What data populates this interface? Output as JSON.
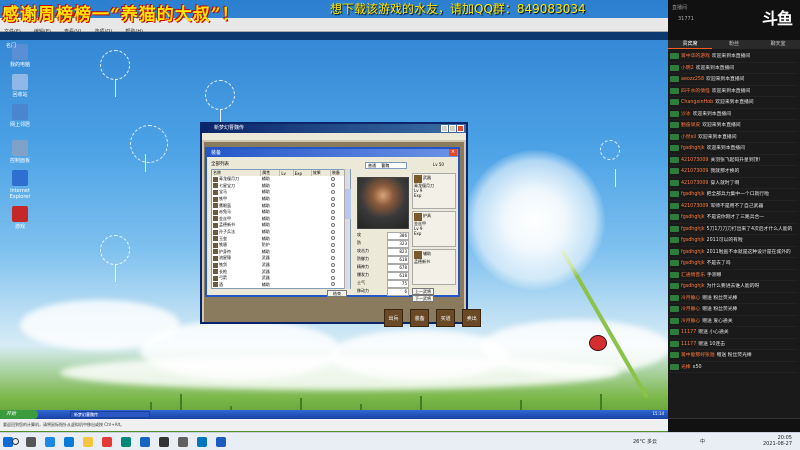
{
  "banner": {
    "left": "感谢周榜榜一“养猫的大叔”！",
    "right": "想下载该游戏的水友，请加QQ群：849083034"
  },
  "desktop_icons": [
    {
      "label": "我的电脑",
      "color": "#5a8fd6"
    },
    {
      "label": "回收站",
      "color": "#8fb7e8"
    },
    {
      "label": "网上邻居",
      "color": "#4a86d0"
    },
    {
      "label": "控制面板",
      "color": "#7fa3c8"
    },
    {
      "label": "Internet Explorer",
      "color": "#2f6fd0"
    },
    {
      "label": "游戏",
      "color": "#c62828"
    }
  ],
  "game": {
    "window_title": "新梦幻曹魏传",
    "dialog_title": "装备",
    "list_header": "全部列表",
    "columns": [
      "名称",
      "属性",
      "Lv",
      "Exp",
      "效果",
      "装备"
    ],
    "items": [
      {
        "name": "青龙偃月刀",
        "type": "辅助",
        "lv": "",
        "exp": "",
        "eff": "",
        "eq": ""
      },
      {
        "name": "七星宝刀",
        "type": "辅助",
        "lv": "",
        "exp": "",
        "eff": "",
        "eq": ""
      },
      {
        "name": "宝马",
        "type": "辅助",
        "lv": "",
        "exp": "",
        "eff": "",
        "eq": ""
      },
      {
        "name": "铁甲",
        "type": "辅助",
        "lv": "",
        "exp": "",
        "eff": "",
        "eq": ""
      },
      {
        "name": "鹰眼盔",
        "type": "辅助",
        "lv": "",
        "exp": "",
        "eff": "",
        "eq": ""
      },
      {
        "name": "赤兔马",
        "type": "辅助",
        "lv": "",
        "exp": "",
        "eff": "",
        "eq": ""
      },
      {
        "name": "金丝甲",
        "type": "辅助",
        "lv": "",
        "exp": "",
        "eff": "",
        "eq": ""
      },
      {
        "name": "孟德新书",
        "type": "辅助",
        "lv": "",
        "exp": "",
        "eff": "",
        "eq": ""
      },
      {
        "name": "孙子兵法",
        "type": "辅助",
        "lv": "",
        "exp": "",
        "eff": "",
        "eq": ""
      },
      {
        "name": "玉玺",
        "type": "辅助",
        "lv": "",
        "exp": "",
        "eff": "",
        "eq": ""
      },
      {
        "name": "铁盾",
        "type": "防护",
        "lv": "",
        "exp": "",
        "eff": "",
        "eq": ""
      },
      {
        "name": "护身符",
        "type": "辅助",
        "lv": "",
        "exp": "",
        "eff": "",
        "eq": ""
      },
      {
        "name": "流星锤",
        "type": "武器",
        "lv": "",
        "exp": "",
        "eff": "",
        "eq": ""
      },
      {
        "name": "铁剑",
        "type": "武器",
        "lv": "",
        "exp": "",
        "eff": "",
        "eq": ""
      },
      {
        "name": "长枪",
        "type": "武器",
        "lv": "",
        "exp": "",
        "eff": "",
        "eq": ""
      },
      {
        "name": "弓箭",
        "type": "武器",
        "lv": "",
        "exp": "",
        "eff": "",
        "eq": ""
      },
      {
        "name": "酒",
        "type": "辅助",
        "lv": "",
        "exp": "",
        "eff": "",
        "eq": ""
      }
    ],
    "ok_label": "结束",
    "combo_value": "普通",
    "combo_value2": "曹魏",
    "level_label": "Lv",
    "level_value": "50",
    "stats": [
      {
        "k": "攻",
        "v": "386"
      },
      {
        "k": "防",
        "v": "323"
      },
      {
        "k": "攻击力",
        "v": "823"
      },
      {
        "k": "防御力",
        "v": "618"
      },
      {
        "k": "精神力",
        "v": "678"
      },
      {
        "k": "爆发力",
        "v": "618"
      },
      {
        "k": "士气",
        "v": "75"
      },
      {
        "k": "移动力",
        "v": "6"
      }
    ],
    "slots": [
      {
        "label": "武器",
        "name": "青龙偃月刀",
        "lv": "Lv 9",
        "exp": "Exp"
      },
      {
        "label": "护具",
        "name": "金丝甲",
        "lv": "Lv 9",
        "exp": "Exp"
      },
      {
        "label": "辅助",
        "name": "孟德新书",
        "lv": "",
        "exp": ""
      }
    ],
    "slot_buttons": [
      "上一武将",
      "下一武将"
    ],
    "actions": [
      "出兵",
      "装备",
      "买道",
      "卖出"
    ]
  },
  "outer": {
    "toolbar_items": [
      "文件(F)",
      "编辑(E)",
      "查看(V)",
      "选项(O)",
      "帮助(H)"
    ],
    "tab_label": "名门",
    "xp_start": "开始",
    "xp_task": "新梦幻曹魏传",
    "xp_clock": "15:14",
    "status_text": "要返回到您的计算机，请将鼠标指针从虚拟机中移出或按 Ctrl+Alt。"
  },
  "taskbar": {
    "weather": "26°C 多云",
    "ime": "中",
    "time": "20:05",
    "date": "2021-08-27"
  },
  "chat": {
    "room_label": "直播间",
    "viewers": "31771",
    "logo": "斗鱼",
    "tabs": [
      "贵宾席",
      "粉丝",
      "聊天室"
    ],
    "messages": [
      {
        "badge": "",
        "user": "蒋中华的游戏",
        "text": "欢迎来到本直播间"
      },
      {
        "badge": "",
        "user": "小明2",
        "text": "欢迎来到本直播间"
      },
      {
        "badge": "",
        "user": "aeozz258",
        "text": "欢迎来到本直播间"
      },
      {
        "badge": "",
        "user": "四千水的情怪",
        "text": "欢迎来到本直播间"
      },
      {
        "badge": "",
        "user": "ChangxinHob",
        "text": "欢迎来到本直播间"
      },
      {
        "badge": "",
        "user": "沙冰",
        "text": "欢迎来到本直播间"
      },
      {
        "badge": "",
        "user": "勤奋顽皮",
        "text": "欢迎来到本直播间"
      },
      {
        "badge": "",
        "user": "小然xil",
        "text": "欢迎来到本直播间"
      },
      {
        "badge": "",
        "user": "fgsdhghjk",
        "text": "欢迎来到本直播间"
      },
      {
        "badge": "",
        "user": "421073009",
        "text": "关羽张飞起码升星到顶！"
      },
      {
        "badge": "",
        "user": "421073009",
        "text": "我就那才换的"
      },
      {
        "badge": "",
        "user": "421073009",
        "text": "穿人就时了啊"
      },
      {
        "badge": "",
        "user": "fgsdhghjk",
        "text": "把全部兵力集中一个口就行啦"
      },
      {
        "badge": "",
        "user": "421073009",
        "text": "军师不是用不了自己武器"
      },
      {
        "badge": "",
        "user": "fgsdhghjk",
        "text": "不是说你刚才了三路兵合一"
      },
      {
        "badge": "",
        "user": "fgsdhghjk",
        "text": "5刀1刀刀刀打出来了4次后才什么人能的"
      },
      {
        "badge": "",
        "user": "fgsdhghjk",
        "text": "2011可以的有啦"
      },
      {
        "badge": "",
        "user": "fgsdhghjk",
        "text": "2011啦画不本就是这种设计是在城外的"
      },
      {
        "badge": "",
        "user": "fgsdhghjk",
        "text": "不是去了吗"
      },
      {
        "badge": "",
        "user": "汇通情音乐",
        "text": "手测哪"
      },
      {
        "badge": "",
        "user": "fgsdhghjk",
        "text": "为什么要进去谁人能的呀"
      },
      {
        "badge": "",
        "user": "冷月静心",
        "text": "赠送 粉丝荧光棒"
      },
      {
        "badge": "",
        "user": "冷月静心",
        "text": "赠送 粉丝荧光棒"
      },
      {
        "badge": "",
        "user": "冷月静心",
        "text": "赠送 爱心通关"
      },
      {
        "badge": "",
        "user": "11177",
        "text": "赠送 小心通关"
      },
      {
        "badge": "",
        "user": "11177",
        "text": "赠送 10连击"
      },
      {
        "badge": "",
        "user": "蒋中能那好张驰",
        "text": "赠送 粉丝荧光棒"
      },
      {
        "badge": "",
        "user": "光棒",
        "text": "x50"
      }
    ]
  }
}
